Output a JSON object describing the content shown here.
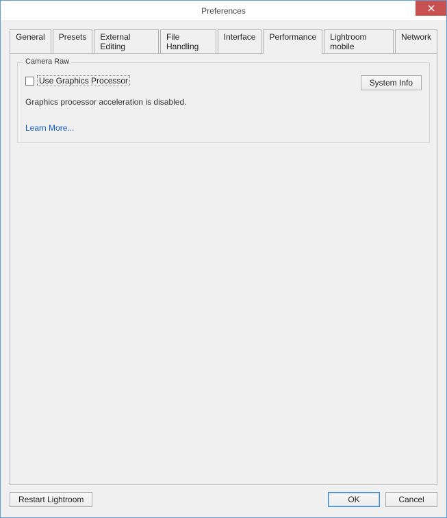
{
  "window": {
    "title": "Preferences"
  },
  "tabs": {
    "general": "General",
    "presets": "Presets",
    "external_editing": "External Editing",
    "file_handling": "File Handling",
    "interface": "Interface",
    "performance": "Performance",
    "lightroom_mobile": "Lightroom mobile",
    "network": "Network"
  },
  "group": {
    "title": "Camera Raw",
    "checkbox_label": "Use Graphics Processor",
    "status": "Graphics processor acceleration is disabled.",
    "learn_more": "Learn More...",
    "system_info": "System Info"
  },
  "footer": {
    "restart": "Restart Lightroom",
    "ok": "OK",
    "cancel": "Cancel"
  }
}
